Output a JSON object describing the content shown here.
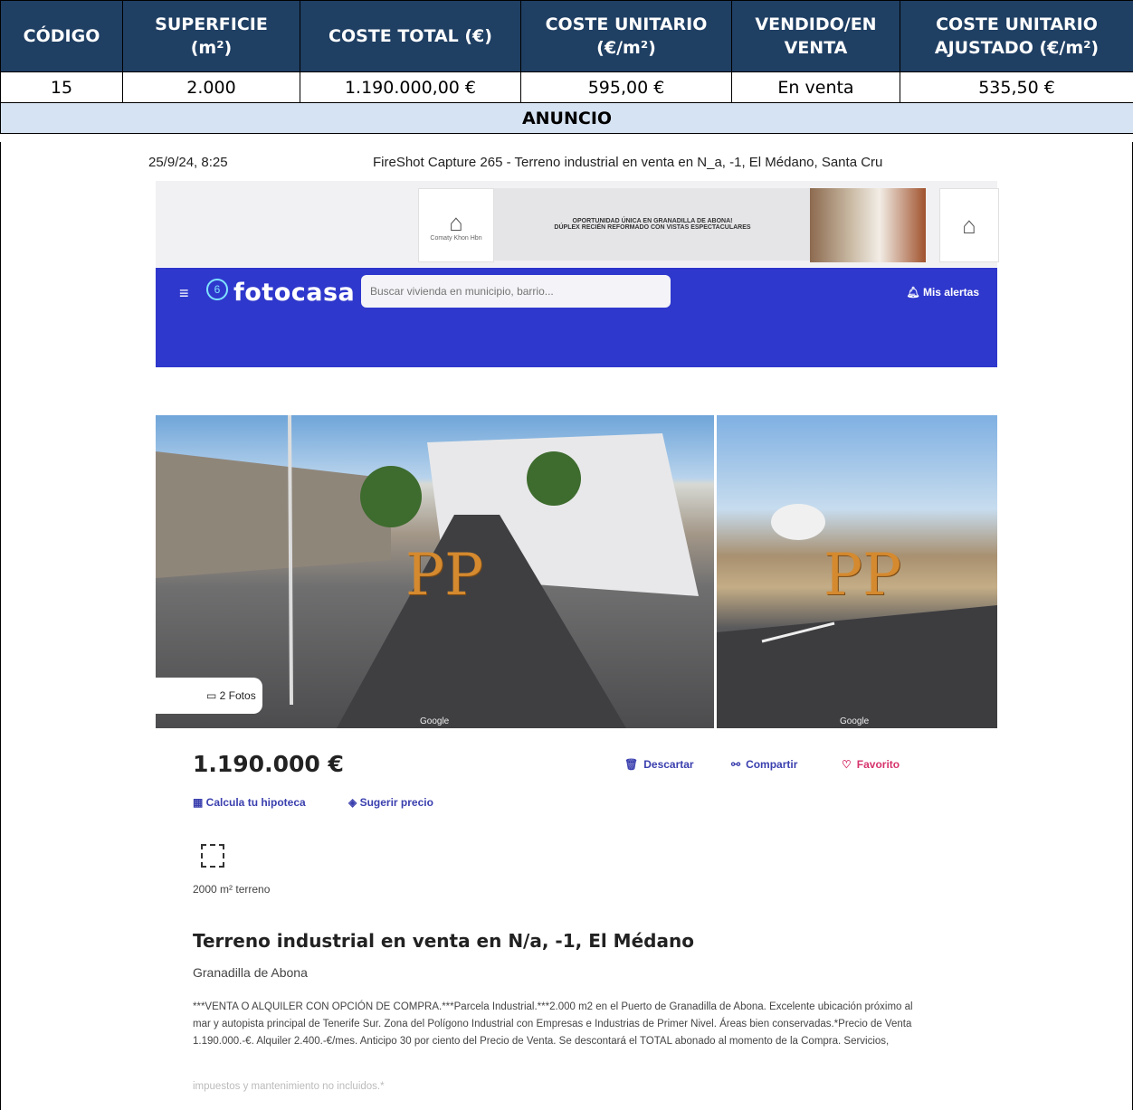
{
  "table": {
    "headers": [
      {
        "line1": "CÓDIGO",
        "line2": ""
      },
      {
        "line1": "SUPERFICIE",
        "line2": "(m²)"
      },
      {
        "line1": "COSTE TOTAL (€)",
        "line2": ""
      },
      {
        "line1": "COSTE UNITARIO",
        "line2": "(€/m²)"
      },
      {
        "line1": "VENDIDO/EN",
        "line2": "VENTA"
      },
      {
        "line1": "COSTE UNITARIO",
        "line2": "AJUSTADO (€/m²)"
      }
    ],
    "row": [
      "15",
      "2.000",
      "1.190.000,00 €",
      "595,00 €",
      "En venta",
      "535,50 €"
    ],
    "section_label": "ANUNCIO"
  },
  "capture": {
    "date": "25/9/24, 8:25",
    "title": "FireShot Capture 265 - Terreno industrial en venta en N_a, -1, El Médano, Santa Cru"
  },
  "banner": {
    "brand_small": "Comaty Khon Hbn",
    "ad_line1": "OPORTUNIDAD ÚNICA EN GRANADILLA DE ABONA!",
    "ad_line2": "DÚPLEX RECIÉN REFORMADO CON VISTAS ESPECTACULARES"
  },
  "nav": {
    "logo": "fotocasa",
    "search_placeholder": "Buscar vivienda en municipio, barrio...",
    "alerts": "Mis alertas"
  },
  "gallery": {
    "photos_label": "2 Fotos",
    "watermark": "PP",
    "google": "Google"
  },
  "listing": {
    "price": "1.190.000 €",
    "discard": "Descartar",
    "share": "Compartir",
    "favorite": "Favorito",
    "mortgage": "Calcula tu hipoteca",
    "suggest": "Sugerir precio",
    "area": "2000 m² terreno",
    "title": "Terreno industrial en venta en N/a, -1, El Médano",
    "location": "Granadilla de Abona",
    "description": "***VENTA O ALQUILER CON OPCIÓN DE COMPRA.***Parcela Industrial.***2.000 m2 en el Puerto de Granadilla de Abona. Excelente ubicación próximo al mar y autopista principal de Tenerife Sur. Zona del Polígono Industrial con Empresas e Industrias de Primer Nivel. Áreas bien conservadas.*Precio de Venta 1.190.000.-€. Alquiler 2.400.-€/mes. Anticipo 30 por ciento del Precio de Venta. Se descontará el TOTAL abonado al momento de la Compra. Servicios,",
    "description_fade": "impuestos y mantenimiento no incluidos.*"
  }
}
